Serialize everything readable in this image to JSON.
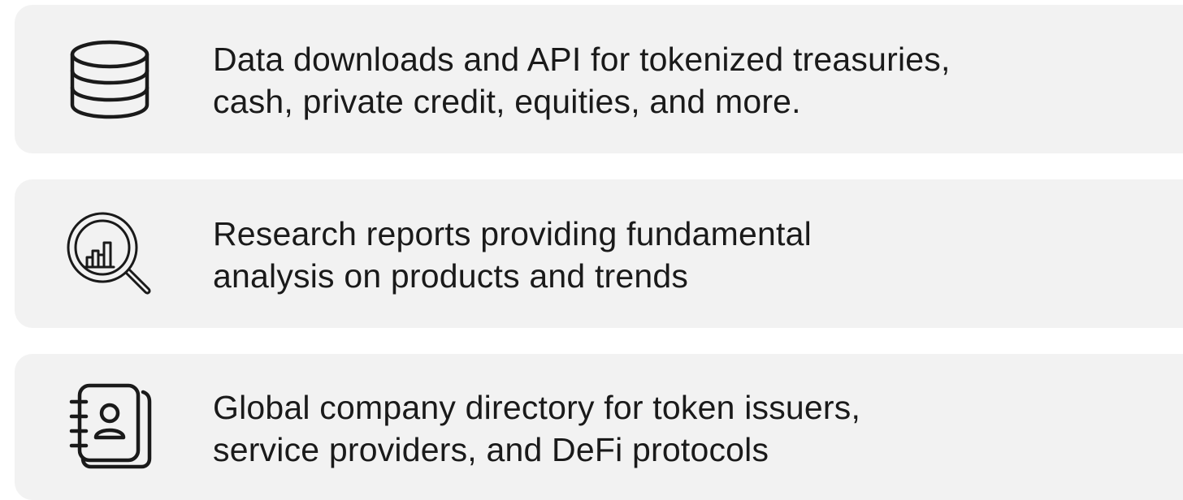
{
  "features": [
    {
      "icon": "database-icon",
      "lines": [
        "Data downloads and API for tokenized treasuries,",
        "cash, private credit, equities, and more."
      ]
    },
    {
      "icon": "magnifier-chart-icon",
      "lines": [
        "Research reports providing fundamental",
        "analysis on products and trends"
      ]
    },
    {
      "icon": "contact-book-icon",
      "lines": [
        "Global company directory for token issuers,",
        "service providers, and DeFi protocols"
      ]
    }
  ],
  "colors": {
    "card_background": "#f2f2f2",
    "text": "#1a1a1a",
    "icon_stroke": "#1a1a1a"
  }
}
